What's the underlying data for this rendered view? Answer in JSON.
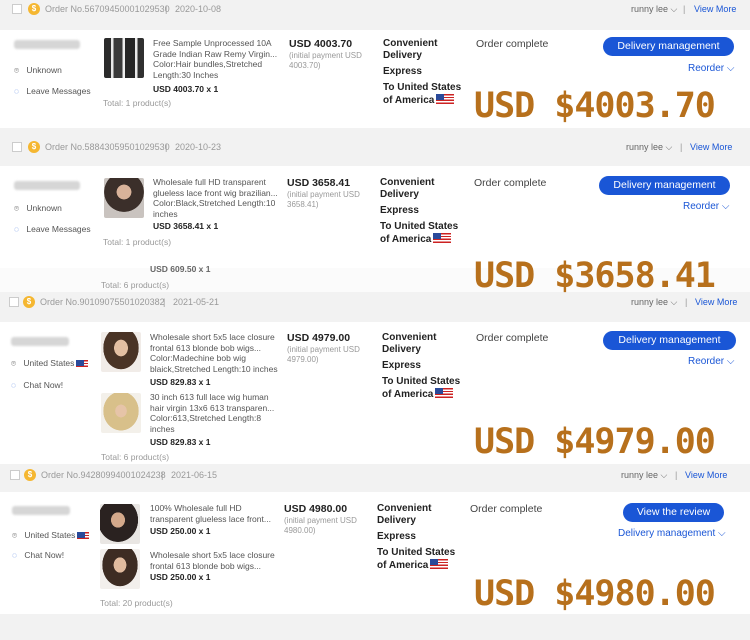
{
  "orders": [
    {
      "order_no": "Order No.56709450001029530",
      "date": "2020-10-08",
      "seller": "runny lee",
      "view_more": "View More",
      "location": "Unknown",
      "contact": "Leave Messages",
      "items": [
        {
          "desc": "Free Sample Unprocessed 10A Grade Indian Raw Remy Virgin... Color:Hair bundles,Stretched Length:30 Inches",
          "price": "USD 4003.70 x 1"
        }
      ],
      "total": "Total:  1 product(s)",
      "amount": "USD 4003.70",
      "initial_payment": "(initial payment USD 4003.70)",
      "ship_method": "Convenient Delivery",
      "ship_express": "Express",
      "ship_dest": "To United States of America",
      "status": "Order complete",
      "primary_button": "Delivery management",
      "secondary_link": "Reorder",
      "overlay": "USD $4003.70"
    },
    {
      "order_no": "Order No.58843059501029530",
      "date": "2020-10-23",
      "seller": "runny lee",
      "view_more": "View More",
      "location": "Unknown",
      "contact": "Leave Messages",
      "items": [
        {
          "desc": "Wholesale full HD transparent glueless lace front wig brazilian... Color:Black,Stretched Length:10 inches",
          "price": "USD 3658.41 x 1"
        }
      ],
      "total": "Total:  1 product(s)",
      "amount": "USD 3658.41",
      "initial_payment": "(initial payment USD 3658.41)",
      "ship_method": "Convenient Delivery",
      "ship_express": "Express",
      "ship_dest": "To United States of America",
      "status": "Order complete",
      "primary_button": "Delivery management",
      "secondary_link": "Reorder",
      "overlay": "USD $3658.41"
    },
    {
      "order_no": "Order No.90109075501020382",
      "date": "2021-05-21",
      "seller": "runny lee",
      "view_more": "View More",
      "location": "United States",
      "contact": "Chat Now!",
      "items": [
        {
          "desc": "Wholesale short 5x5 lace closure frontal 613 blonde bob wigs... Color:Madechine bob wig blaick,Stretched Length:10 inches",
          "price": "USD 829.83 x 1"
        },
        {
          "desc": "30 inch 613 full lace wig human hair virgin 13x6 613 transparen... Color:613,Stretched Length:8 inches",
          "price": "USD 829.83 x 1"
        }
      ],
      "total": "Total:  6 product(s)",
      "amount": "USD 4979.00",
      "initial_payment": "(initial payment USD 4979.00)",
      "ship_method": "Convenient Delivery",
      "ship_express": "Express",
      "ship_dest": "To United States of America",
      "status": "Order complete",
      "primary_button": "Delivery management",
      "secondary_link": "Reorder",
      "overlay": "USD $4979.00"
    },
    {
      "order_no": "Order No.94280994001024238",
      "date": "2021-06-15",
      "seller": "runny lee",
      "view_more": "View More",
      "location": "United States",
      "contact": "Chat Now!",
      "items": [
        {
          "desc": "100% Wholesale full HD transparent glueless lace front...",
          "price": "USD 250.00 x 1"
        },
        {
          "desc": "Wholesale short 5x5 lace closure frontal 613 blonde bob wigs...",
          "price": "USD 250.00 x 1"
        }
      ],
      "total": "Total:  20 product(s)",
      "amount": "USD 4980.00",
      "initial_payment": "(initial payment USD 4980.00)",
      "ship_method": "Convenient Delivery",
      "ship_express": "Express",
      "ship_dest": "To United States of America",
      "status": "Order complete",
      "primary_button": "View the review",
      "secondary_link": "Delivery management",
      "overlay": "USD $4980.00"
    }
  ],
  "partial_row": {
    "price": "USD 609.50 x 1",
    "total": "Total:  6 product(s)"
  },
  "colors": {
    "accent": "#1a56d6",
    "overlay": "#b7701c",
    "coin": "#f5b731"
  },
  "icons": {
    "location": "location-pin-icon",
    "message": "message-icon",
    "chevron": "chevron-down-icon",
    "flag": "us-flag-icon",
    "coin": "coin-icon"
  }
}
